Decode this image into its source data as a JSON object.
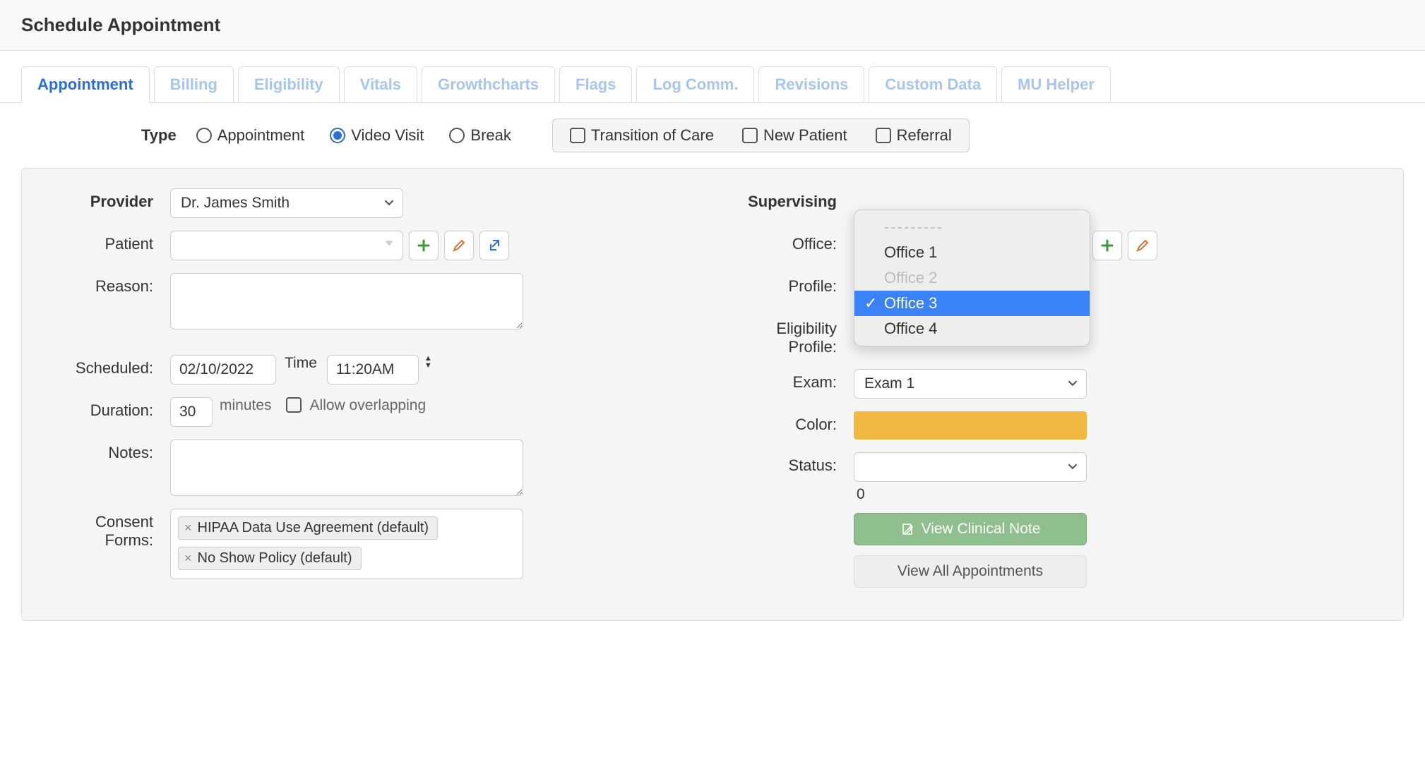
{
  "header": {
    "title": "Schedule Appointment"
  },
  "tabs": [
    "Appointment",
    "Billing",
    "Eligibility",
    "Vitals",
    "Growthcharts",
    "Flags",
    "Log Comm.",
    "Revisions",
    "Custom Data",
    "MU Helper"
  ],
  "active_tab": "Appointment",
  "type_row": {
    "label": "Type",
    "radios": [
      "Appointment",
      "Video Visit",
      "Break"
    ],
    "selected_radio": "Video Visit",
    "checks": [
      "Transition of Care",
      "New Patient",
      "Referral"
    ]
  },
  "left": {
    "provider_label": "Provider",
    "provider_value": "Dr. James Smith",
    "patient_label": "Patient",
    "reason_label": "Reason:",
    "scheduled_label": "Scheduled:",
    "date_value": "02/10/2022",
    "time_label": "Time",
    "time_value": "11:20AM",
    "duration_label": "Duration:",
    "duration_value": "30",
    "minutes_label": "minutes",
    "allow_overlap_label": "Allow overlapping",
    "notes_label": "Notes:",
    "consent_label_1": "Consent",
    "consent_label_2": "Forms:",
    "consent_tags": [
      "HIPAA Data Use Agreement (default)",
      "No Show Policy (default)"
    ]
  },
  "right": {
    "supervising_label": "Supervising",
    "office_label": "Office:",
    "office_dropdown": {
      "placeholder": "---------",
      "items": [
        "Office 1",
        "Office 2",
        "Office 3",
        "Office 4"
      ],
      "disabled": [
        "Office 2"
      ],
      "selected": "Office 3"
    },
    "profile_label": "Profile:",
    "eligibility_label_1": "Eligibility",
    "eligibility_label_2": "Profile:",
    "eligibility_value": "---------",
    "exam_label": "Exam:",
    "exam_value": "Exam 1",
    "color_label": "Color:",
    "color_hex": "#f0b840",
    "status_label": "Status:",
    "status_count": "0",
    "btn_clinical": "View Clinical Note",
    "btn_allappt": "View All Appointments"
  }
}
